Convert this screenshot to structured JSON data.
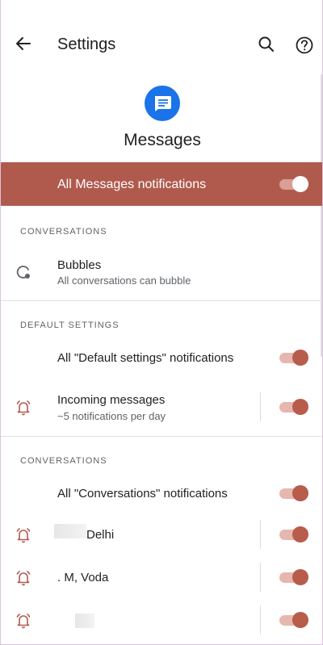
{
  "header": {
    "title": "Settings"
  },
  "app": {
    "name": "Messages"
  },
  "master": {
    "label": "All Messages notifications",
    "enabled": true
  },
  "sections": {
    "conversations_1": {
      "header": "CONVERSATIONS",
      "bubbles": {
        "title": "Bubbles",
        "subtitle": "All conversations can bubble"
      }
    },
    "default_settings": {
      "header": "DEFAULT SETTINGS",
      "all_label": "All \"Default settings\" notifications",
      "incoming": {
        "title": "Incoming messages",
        "subtitle": "~5 notifications per day"
      }
    },
    "conversations_2": {
      "header": "CONVERSATIONS",
      "all_label": "All \"Conversations\" notifications",
      "items": [
        {
          "title": "Delhi"
        },
        {
          "title": ". M, Voda"
        },
        {
          "title": ""
        }
      ]
    }
  },
  "colors": {
    "accent": "#b05a4e",
    "toggle_thumb": "#b85c4c",
    "toggle_track": "#e6b7ae",
    "app_blue": "#1a73e8"
  }
}
